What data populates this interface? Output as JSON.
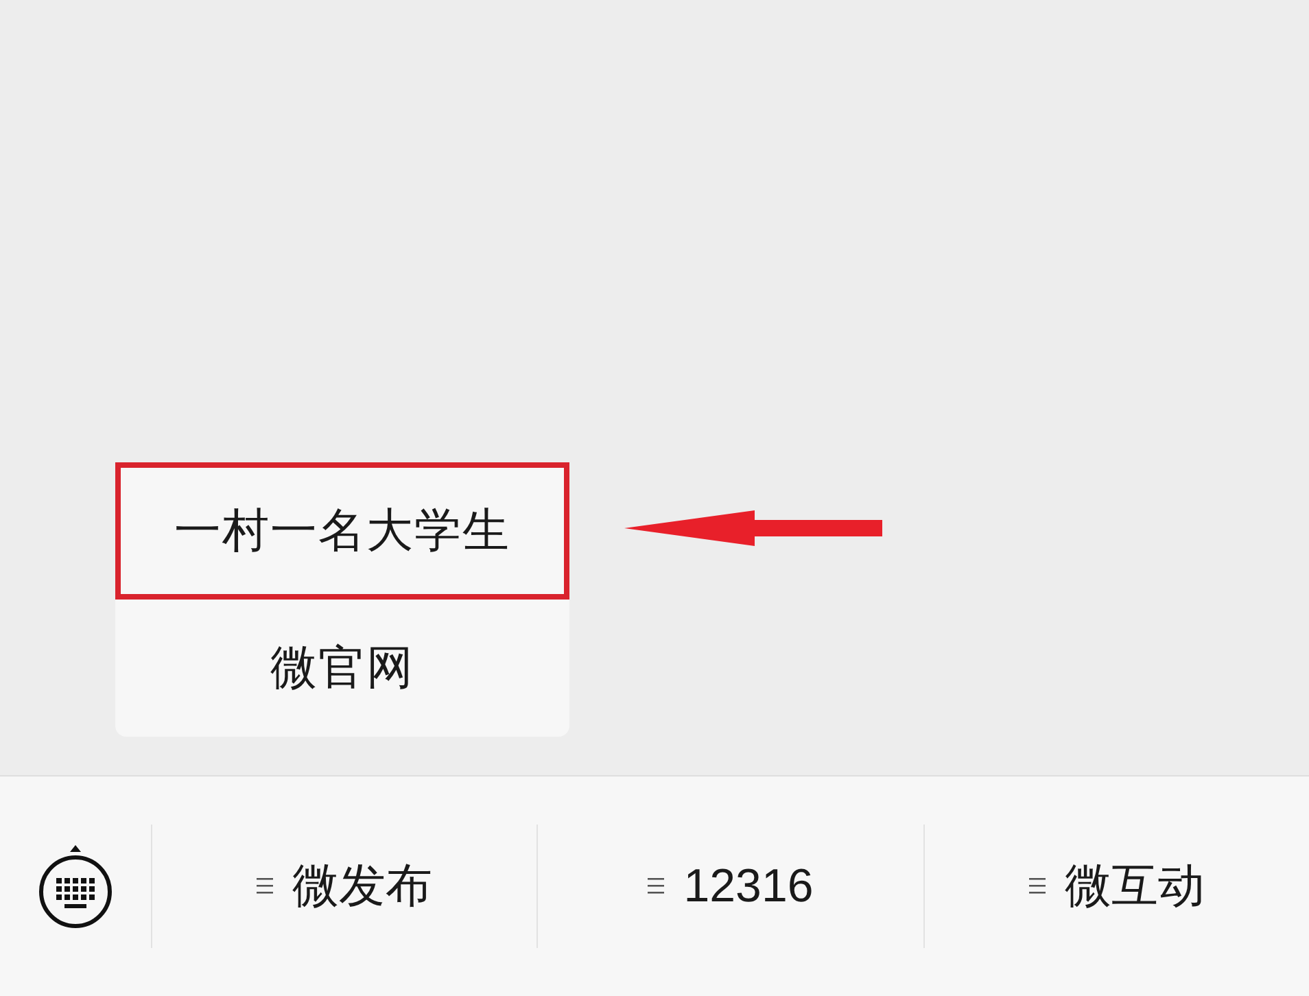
{
  "menu": {
    "items": [
      {
        "label": "一村一名大学生",
        "highlighted": true
      },
      {
        "label": "微官网",
        "highlighted": false
      }
    ]
  },
  "bottom_bar": {
    "tabs": [
      {
        "label": "微发布"
      },
      {
        "label": "12316"
      },
      {
        "label": "微互动"
      }
    ]
  }
}
